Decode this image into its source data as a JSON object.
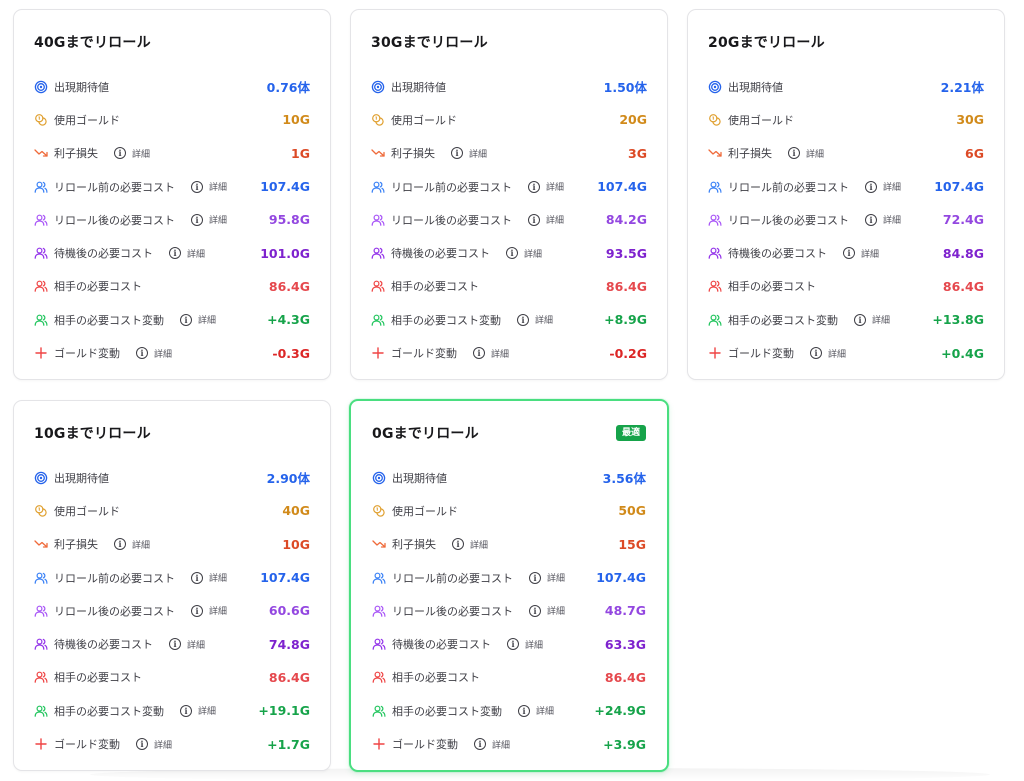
{
  "detail_label": "詳細",
  "colors": {
    "expected": "#2563eb",
    "gold": "#d18a1a",
    "interest": "#dc4a26",
    "before": "#2563eb",
    "after": "#9347e0",
    "wait": "#7e22ce",
    "opponent": "#e5484d",
    "positive": "#16a34a",
    "negative": "#dc2626",
    "best_border": "#4ade80"
  },
  "cards": [
    {
      "title": "40Gまでリロール",
      "best": false,
      "rows": [
        {
          "icon": "target-icon",
          "label": "出現期待値",
          "value": "0.76体",
          "color": "c-blue",
          "detail": false
        },
        {
          "icon": "coins-icon",
          "label": "使用ゴールド",
          "value": "10G",
          "color": "c-orange",
          "detail": false
        },
        {
          "icon": "trending-down-icon",
          "label": "利子損失",
          "value": "1G",
          "color": "c-red",
          "detail": true
        },
        {
          "icon": "users-icon",
          "iconColor": "#3b82f6",
          "label": "リロール前の必要コスト",
          "value": "107.4G",
          "color": "c-blue",
          "detail": true
        },
        {
          "icon": "users-icon",
          "iconColor": "#a855f7",
          "label": "リロール後の必要コスト",
          "value": "95.8G",
          "color": "c-purple",
          "detail": true
        },
        {
          "icon": "users-icon",
          "iconColor": "#9333ea",
          "label": "待機後の必要コスト",
          "value": "101.0G",
          "color": "c-darkpurple",
          "detail": true
        },
        {
          "icon": "users-icon",
          "iconColor": "#ef4444",
          "label": "相手の必要コスト",
          "value": "86.4G",
          "color": "c-pink",
          "detail": false
        },
        {
          "icon": "users-icon",
          "iconColor": "#22c55e",
          "label": "相手の必要コスト変動",
          "value": "+4.3G",
          "color": "c-green",
          "detail": true
        },
        {
          "icon": "plus-icon",
          "label": "ゴールド変動",
          "value": "-0.3G",
          "color": "c-neg",
          "detail": true
        }
      ]
    },
    {
      "title": "30Gまでリロール",
      "best": false,
      "rows": [
        {
          "icon": "target-icon",
          "label": "出現期待値",
          "value": "1.50体",
          "color": "c-blue",
          "detail": false
        },
        {
          "icon": "coins-icon",
          "label": "使用ゴールド",
          "value": "20G",
          "color": "c-orange",
          "detail": false
        },
        {
          "icon": "trending-down-icon",
          "label": "利子損失",
          "value": "3G",
          "color": "c-red",
          "detail": true
        },
        {
          "icon": "users-icon",
          "iconColor": "#3b82f6",
          "label": "リロール前の必要コスト",
          "value": "107.4G",
          "color": "c-blue",
          "detail": true
        },
        {
          "icon": "users-icon",
          "iconColor": "#a855f7",
          "label": "リロール後の必要コスト",
          "value": "84.2G",
          "color": "c-purple",
          "detail": true
        },
        {
          "icon": "users-icon",
          "iconColor": "#9333ea",
          "label": "待機後の必要コスト",
          "value": "93.5G",
          "color": "c-darkpurple",
          "detail": true
        },
        {
          "icon": "users-icon",
          "iconColor": "#ef4444",
          "label": "相手の必要コスト",
          "value": "86.4G",
          "color": "c-pink",
          "detail": false
        },
        {
          "icon": "users-icon",
          "iconColor": "#22c55e",
          "label": "相手の必要コスト変動",
          "value": "+8.9G",
          "color": "c-green",
          "detail": true
        },
        {
          "icon": "plus-icon",
          "label": "ゴールド変動",
          "value": "-0.2G",
          "color": "c-neg",
          "detail": true
        }
      ]
    },
    {
      "title": "20Gまでリロール",
      "best": false,
      "rows": [
        {
          "icon": "target-icon",
          "label": "出現期待値",
          "value": "2.21体",
          "color": "c-blue",
          "detail": false
        },
        {
          "icon": "coins-icon",
          "label": "使用ゴールド",
          "value": "30G",
          "color": "c-orange",
          "detail": false
        },
        {
          "icon": "trending-down-icon",
          "label": "利子損失",
          "value": "6G",
          "color": "c-red",
          "detail": true
        },
        {
          "icon": "users-icon",
          "iconColor": "#3b82f6",
          "label": "リロール前の必要コスト",
          "value": "107.4G",
          "color": "c-blue",
          "detail": true
        },
        {
          "icon": "users-icon",
          "iconColor": "#a855f7",
          "label": "リロール後の必要コスト",
          "value": "72.4G",
          "color": "c-purple",
          "detail": true
        },
        {
          "icon": "users-icon",
          "iconColor": "#9333ea",
          "label": "待機後の必要コスト",
          "value": "84.8G",
          "color": "c-darkpurple",
          "detail": true
        },
        {
          "icon": "users-icon",
          "iconColor": "#ef4444",
          "label": "相手の必要コスト",
          "value": "86.4G",
          "color": "c-pink",
          "detail": false
        },
        {
          "icon": "users-icon",
          "iconColor": "#22c55e",
          "label": "相手の必要コスト変動",
          "value": "+13.8G",
          "color": "c-green",
          "detail": true
        },
        {
          "icon": "plus-icon",
          "label": "ゴールド変動",
          "value": "+0.4G",
          "color": "c-green",
          "detail": true
        }
      ]
    },
    {
      "title": "10Gまでリロール",
      "best": false,
      "rows": [
        {
          "icon": "target-icon",
          "label": "出現期待値",
          "value": "2.90体",
          "color": "c-blue",
          "detail": false
        },
        {
          "icon": "coins-icon",
          "label": "使用ゴールド",
          "value": "40G",
          "color": "c-orange",
          "detail": false
        },
        {
          "icon": "trending-down-icon",
          "label": "利子損失",
          "value": "10G",
          "color": "c-red",
          "detail": true
        },
        {
          "icon": "users-icon",
          "iconColor": "#3b82f6",
          "label": "リロール前の必要コスト",
          "value": "107.4G",
          "color": "c-blue",
          "detail": true
        },
        {
          "icon": "users-icon",
          "iconColor": "#a855f7",
          "label": "リロール後の必要コスト",
          "value": "60.6G",
          "color": "c-purple",
          "detail": true
        },
        {
          "icon": "users-icon",
          "iconColor": "#9333ea",
          "label": "待機後の必要コスト",
          "value": "74.8G",
          "color": "c-darkpurple",
          "detail": true
        },
        {
          "icon": "users-icon",
          "iconColor": "#ef4444",
          "label": "相手の必要コスト",
          "value": "86.4G",
          "color": "c-pink",
          "detail": false
        },
        {
          "icon": "users-icon",
          "iconColor": "#22c55e",
          "label": "相手の必要コスト変動",
          "value": "+19.1G",
          "color": "c-green",
          "detail": true
        },
        {
          "icon": "plus-icon",
          "label": "ゴールド変動",
          "value": "+1.7G",
          "color": "c-green",
          "detail": true
        }
      ]
    },
    {
      "title": "0Gまでリロール",
      "best": true,
      "badge": "最適",
      "rows": [
        {
          "icon": "target-icon",
          "label": "出現期待値",
          "value": "3.56体",
          "color": "c-blue",
          "detail": false
        },
        {
          "icon": "coins-icon",
          "label": "使用ゴールド",
          "value": "50G",
          "color": "c-orange",
          "detail": false
        },
        {
          "icon": "trending-down-icon",
          "label": "利子損失",
          "value": "15G",
          "color": "c-red",
          "detail": true
        },
        {
          "icon": "users-icon",
          "iconColor": "#3b82f6",
          "label": "リロール前の必要コスト",
          "value": "107.4G",
          "color": "c-blue",
          "detail": true
        },
        {
          "icon": "users-icon",
          "iconColor": "#a855f7",
          "label": "リロール後の必要コスト",
          "value": "48.7G",
          "color": "c-purple",
          "detail": true
        },
        {
          "icon": "users-icon",
          "iconColor": "#9333ea",
          "label": "待機後の必要コスト",
          "value": "63.3G",
          "color": "c-darkpurple",
          "detail": true
        },
        {
          "icon": "users-icon",
          "iconColor": "#ef4444",
          "label": "相手の必要コスト",
          "value": "86.4G",
          "color": "c-pink",
          "detail": false
        },
        {
          "icon": "users-icon",
          "iconColor": "#22c55e",
          "label": "相手の必要コスト変動",
          "value": "+24.9G",
          "color": "c-green",
          "detail": true
        },
        {
          "icon": "plus-icon",
          "label": "ゴールド変動",
          "value": "+3.9G",
          "color": "c-green",
          "detail": true
        }
      ]
    }
  ]
}
